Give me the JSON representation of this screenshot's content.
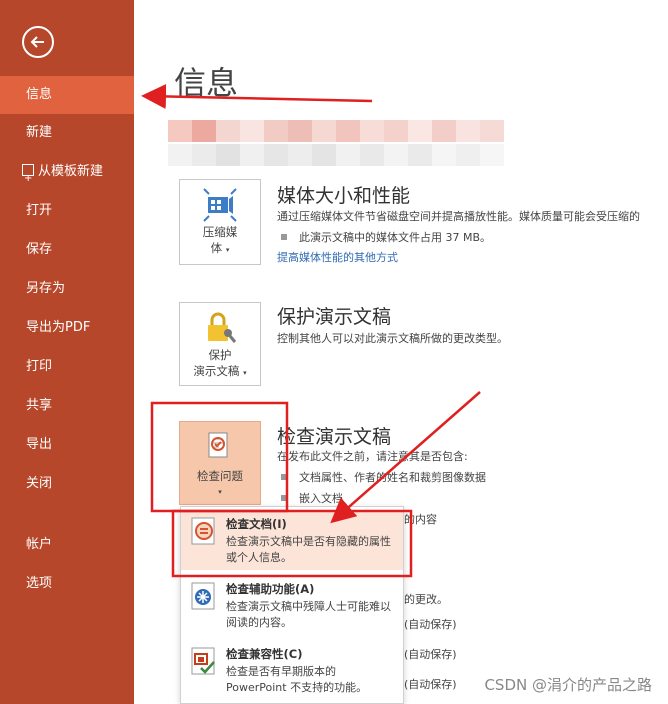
{
  "sidebar": {
    "back_label": "",
    "items": [
      {
        "label": "信息",
        "active": true
      },
      {
        "label": "新建"
      },
      {
        "label": "从模板新建"
      },
      {
        "label": "打开"
      },
      {
        "label": "保存"
      },
      {
        "label": "另存为"
      },
      {
        "label": "导出为PDF"
      },
      {
        "label": "打印"
      },
      {
        "label": "共享"
      },
      {
        "label": "导出"
      },
      {
        "label": "关闭"
      },
      {
        "label": "帐户"
      },
      {
        "label": "选项"
      }
    ]
  },
  "main": {
    "title": "信息",
    "media": {
      "button_line1": "压缩媒",
      "button_line2": "体",
      "title": "媒体大小和性能",
      "desc": "通过压缩媒体文件节省磁盘空间并提高播放性能。媒体质量可能会受压缩的",
      "bullet": "此演示文稿中的媒体文件占用 37 MB。",
      "link": "提高媒体性能的其他方式"
    },
    "protect": {
      "button_line1": "保护",
      "button_line2": "演示文稿",
      "title": "保护演示文稿",
      "desc": "控制其他人可以对此演示文稿所做的更改类型。"
    },
    "inspect": {
      "button_label": "检查问题",
      "title": "检查演示文稿",
      "desc": "在发布此文件之前，请注意其是否包含:",
      "bullet1": "文档属性、作者的姓名和裁剪图像数据",
      "bullet2": "嵌入文档",
      "partial1": "的内容",
      "partial2": "的更改。",
      "partial3": "(自动保存)",
      "partial4": "(自动保存)",
      "partial5": "(自动保存)"
    }
  },
  "dropdown": {
    "items": [
      {
        "title": "检查文档(I)",
        "desc": "检查演示文稿中是否有隐藏的属性或个人信息。"
      },
      {
        "title": "检查辅助功能(A)",
        "desc": "检查演示文稿中残障人士可能难以阅读的内容。"
      },
      {
        "title": "检查兼容性(C)",
        "desc": "检查是否有早期版本的 PowerPoint 不支持的功能。"
      }
    ]
  },
  "watermark": "CSDN @涓介的产品之路",
  "colors": {
    "sidebar": "#b7472a",
    "active": "#e0623e",
    "highlight": "#f6c7aa",
    "annotation": "#e02020",
    "link": "#2e6bb2"
  }
}
